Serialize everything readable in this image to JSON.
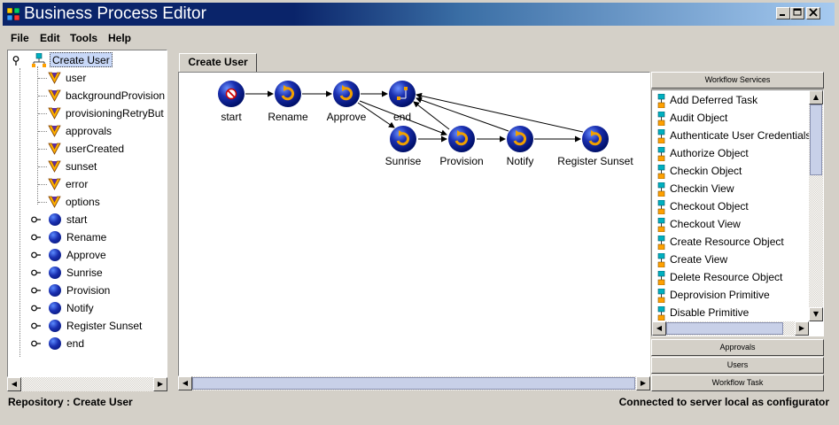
{
  "window": {
    "title": "Business Process Editor"
  },
  "menu": {
    "items": [
      "File",
      "Edit",
      "Tools",
      "Help"
    ]
  },
  "tree": {
    "root": {
      "label": "Create User"
    },
    "variables": [
      "user",
      "backgroundProvision",
      "provisioningRetryBut",
      "approvals",
      "userCreated",
      "sunset",
      "error",
      "options"
    ],
    "activities": [
      "start",
      "Rename",
      "Approve",
      "Sunrise",
      "Provision",
      "Notify",
      "Register Sunset",
      "end"
    ]
  },
  "tabs": [
    {
      "label": "Create User",
      "active": true
    }
  ],
  "workflow": {
    "nodes": [
      {
        "id": "start",
        "label": "start",
        "icon": "no-entry-icon"
      },
      {
        "id": "rename",
        "label": "Rename",
        "icon": "refresh-icon"
      },
      {
        "id": "approve",
        "label": "Approve",
        "icon": "refresh-icon"
      },
      {
        "id": "end",
        "label": "end",
        "icon": "flowchart-icon"
      },
      {
        "id": "sunrise",
        "label": "Sunrise",
        "icon": "refresh-icon"
      },
      {
        "id": "provision",
        "label": "Provision",
        "icon": "refresh-icon"
      },
      {
        "id": "notify",
        "label": "Notify",
        "icon": "refresh-icon"
      },
      {
        "id": "register_sunset",
        "label": "Register Sunset",
        "icon": "refresh-icon"
      }
    ],
    "edges": [
      [
        "start",
        "rename"
      ],
      [
        "rename",
        "approve"
      ],
      [
        "approve",
        "end"
      ],
      [
        "approve",
        "sunrise"
      ],
      [
        "approve",
        "provision"
      ],
      [
        "sunrise",
        "provision"
      ],
      [
        "provision",
        "notify"
      ],
      [
        "notify",
        "register_sunset"
      ],
      [
        "provision",
        "end"
      ],
      [
        "notify",
        "end"
      ],
      [
        "register_sunset",
        "end"
      ]
    ]
  },
  "right_panel": {
    "workflow_services_header": "Workflow Services",
    "services": [
      "Add Deferred Task",
      "Audit Object",
      "Authenticate User Credentials",
      "Authorize Object",
      "Checkin Object",
      "Checkin View",
      "Checkout Object",
      "Checkout View",
      "Create Resource Object",
      "Create View",
      "Delete Resource Object",
      "Deprovision Primitive",
      "Disable Primitive"
    ],
    "approvals_header": "Approvals",
    "users_header": "Users",
    "workflow_task_header": "Workflow Task"
  },
  "status": {
    "left": "Repository : Create User",
    "right": "Connected to server local as configurator"
  },
  "colors": {
    "titlebar_start": "#0a246a",
    "titlebar_end": "#a6caf0",
    "node_blue": "#1a2fb0",
    "node_orange": "#f0a000",
    "chrome": "#d4d0c8"
  }
}
